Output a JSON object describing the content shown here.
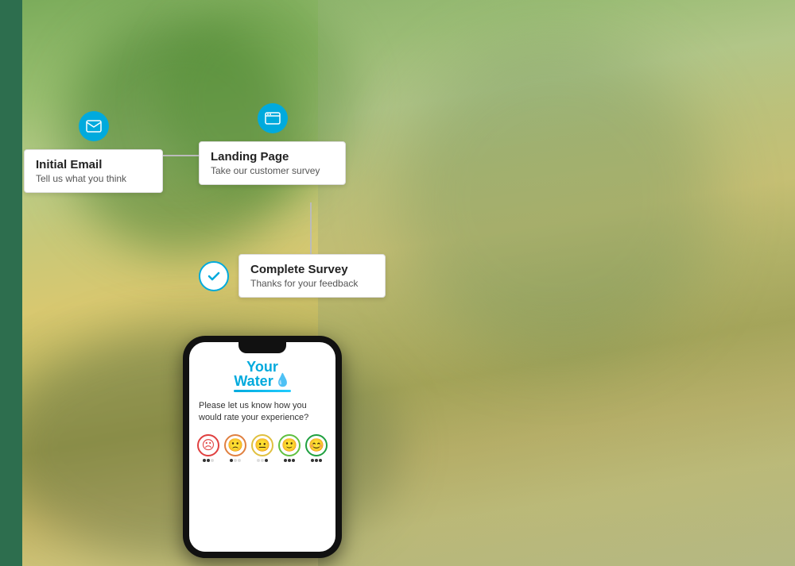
{
  "green_sidebar": true,
  "steps": {
    "step1": {
      "title": "Initial Email",
      "subtitle": "Tell us what you think",
      "icon": "email"
    },
    "step2": {
      "title": "Landing Page",
      "subtitle": "Take our customer survey",
      "icon": "browser"
    },
    "step3": {
      "title": "Complete Survey",
      "subtitle": "Thanks for your feedback",
      "icon": "check"
    }
  },
  "phone": {
    "logo_your": "Your",
    "logo_water": "Water",
    "question": "Please let us know how you would rate your experience?",
    "emojis": [
      "😡",
      "😟",
      "😐",
      "🙂",
      "😊"
    ],
    "emoji_colors": [
      "#e04040",
      "#e08040",
      "#e0c040",
      "#60c040",
      "#20a040"
    ],
    "active_dot": 0
  },
  "colors": {
    "accent": "#00aadd",
    "green_sidebar": "#2d6e4e",
    "card_border": "#dddddd"
  }
}
